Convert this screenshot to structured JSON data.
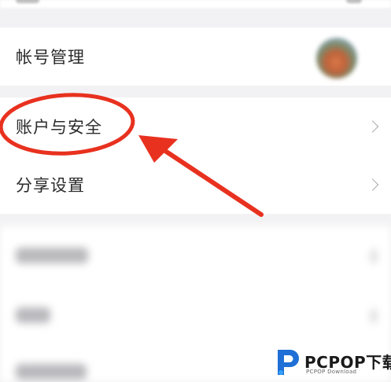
{
  "settings_list": {
    "account_management": {
      "label": "帐号管理",
      "avatar_icon": "user-avatar"
    },
    "account_security": {
      "label": "账户与安全",
      "chevron_icon": "chevron-right-icon"
    },
    "share_settings": {
      "label": "分享设置",
      "chevron_icon": "chevron-right-icon"
    }
  },
  "annotation": {
    "highlight_color": "#e8311f",
    "arrow_color": "#e8311f"
  },
  "watermark": {
    "brand": "PCPOP下载",
    "sub": "PCPOP Download"
  },
  "colors": {
    "background": "#f2f2f4",
    "card": "#ffffff",
    "text": "#2b2b2b",
    "chevron": "#a8a8a8"
  }
}
